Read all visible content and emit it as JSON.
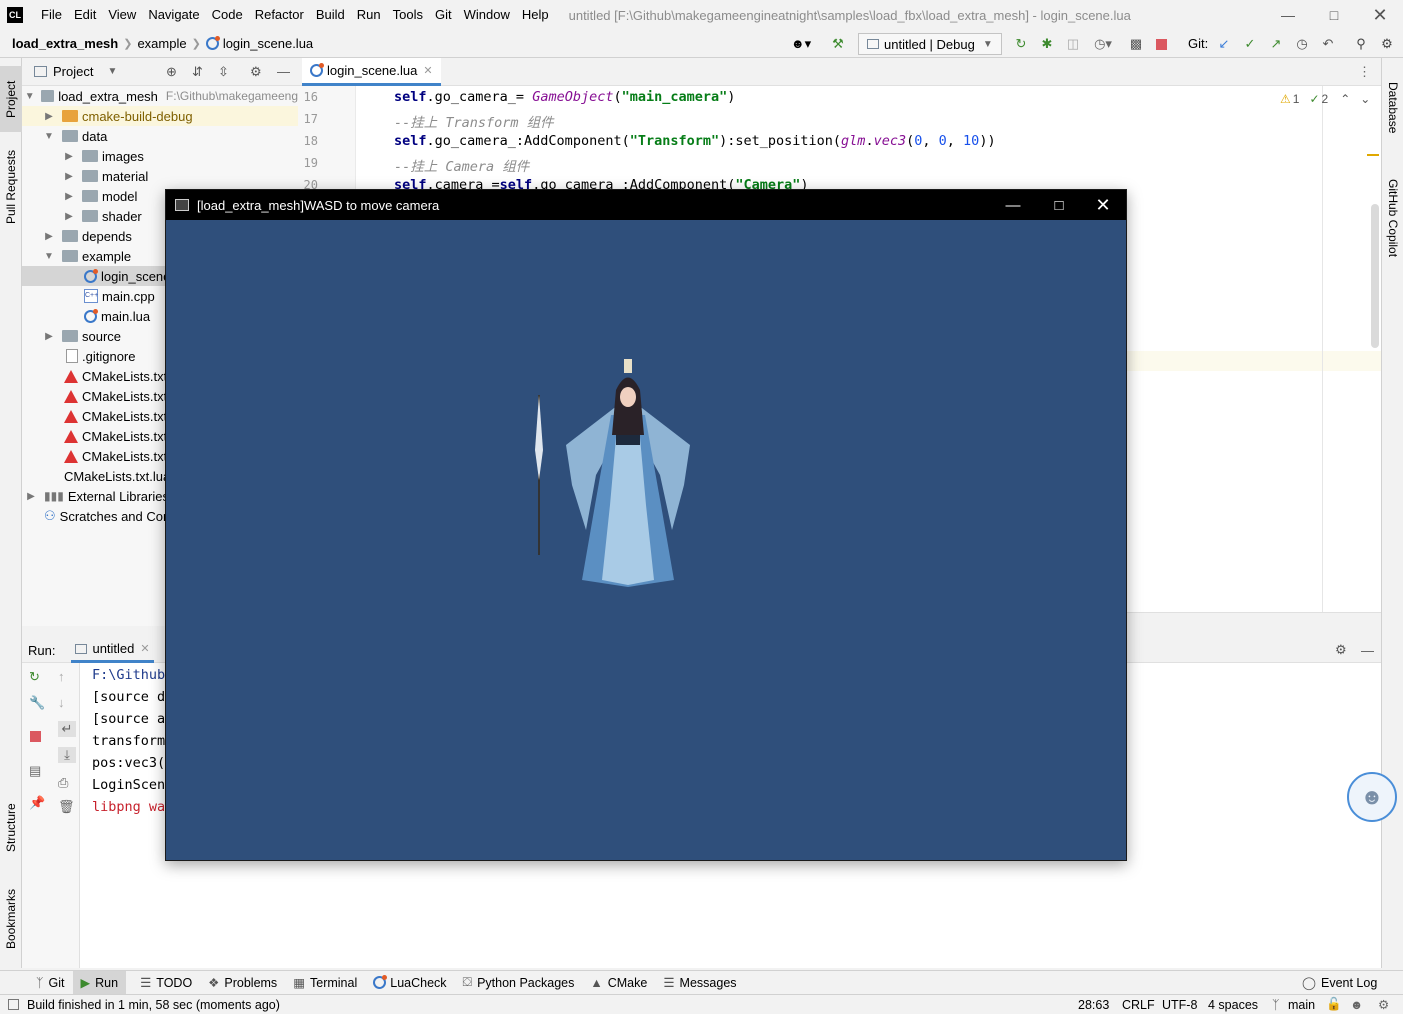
{
  "menubar": {
    "app_icon": "CL",
    "items": [
      "File",
      "Edit",
      "View",
      "Navigate",
      "Code",
      "Refactor",
      "Build",
      "Run",
      "Tools",
      "Git",
      "Window",
      "Help"
    ],
    "title": "untitled [F:\\Github\\makegameengineatnight\\samples\\load_fbx\\load_extra_mesh] - login_scene.lua"
  },
  "nav": {
    "crumbs": [
      "load_extra_mesh",
      "example",
      "login_scene.lua"
    ],
    "run_config": "untitled | Debug",
    "git_label": "Git:"
  },
  "left_strip": {
    "project": "Project",
    "pull_requests": "Pull Requests",
    "structure": "Structure",
    "bookmarks": "Bookmarks"
  },
  "right_strip": {
    "database": "Database",
    "copilot": "GitHub Copilot"
  },
  "project": {
    "header": "Project",
    "tree": [
      {
        "label": "load_extra_mesh",
        "path": "F:\\Github\\makegameeng"
      },
      {
        "label": "cmake-build-debug"
      },
      {
        "label": "data"
      },
      {
        "label": "images"
      },
      {
        "label": "material"
      },
      {
        "label": "model"
      },
      {
        "label": "shader"
      },
      {
        "label": "depends"
      },
      {
        "label": "example"
      },
      {
        "label": "login_scene.lua"
      },
      {
        "label": "main.cpp"
      },
      {
        "label": "main.lua"
      },
      {
        "label": "source"
      },
      {
        "label": ".gitignore"
      },
      {
        "label": "CMakeLists.txt"
      },
      {
        "label": "CMakeLists.txt"
      },
      {
        "label": "CMakeLists.txt"
      },
      {
        "label": "CMakeLists.txt"
      },
      {
        "label": "CMakeLists.txt"
      },
      {
        "label": "CMakeLists.txt.lua"
      },
      {
        "label": "External Libraries"
      },
      {
        "label": "Scratches and Consoles"
      }
    ]
  },
  "editor": {
    "tab": "login_scene.lua",
    "warnings": "1",
    "checks": "2",
    "line_numbers": [
      "16",
      "17",
      "18",
      "19",
      "20"
    ]
  },
  "run": {
    "label": "Run:",
    "tab": "untitled",
    "output": [
      "F:\\Github",
      "[source d",
      "[source a",
      "transform",
      "pos:vec3(",
      "LoginScen",
      "libpng wa"
    ]
  },
  "game_window": {
    "title": "[load_extra_mesh]WASD to move camera",
    "background": "#2f4f7b"
  },
  "bottom_tabs": [
    "Git",
    "Run",
    "TODO",
    "Problems",
    "Terminal",
    "LuaCheck",
    "Python Packages",
    "CMake",
    "Messages"
  ],
  "event_log": "Event Log",
  "status": {
    "message": "Build finished in 1 min, 58 sec (moments ago)",
    "position": "28:63",
    "line_sep": "CRLF",
    "encoding": "UTF-8",
    "indent": "4 spaces",
    "branch": "main"
  }
}
